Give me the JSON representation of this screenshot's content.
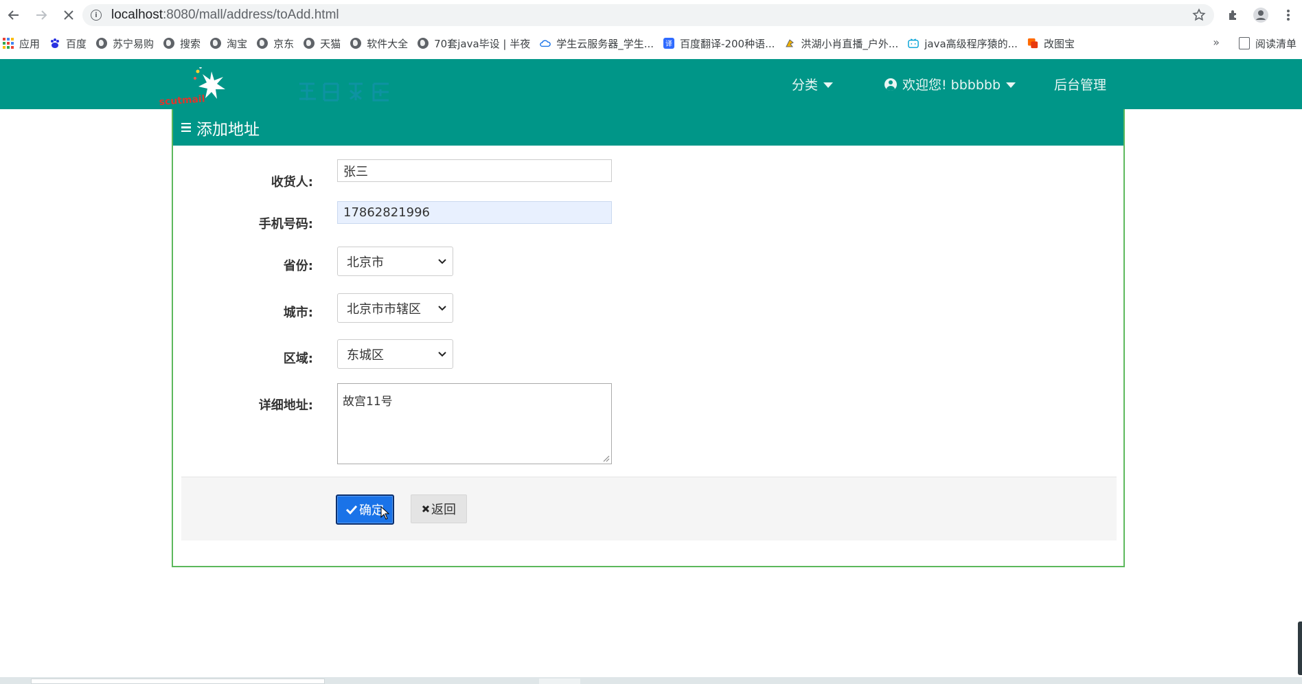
{
  "browser": {
    "url_host": "localhost",
    "url_path": ":8080/mall/address/toAdd.html",
    "bookmarks": [
      {
        "label": "应用",
        "icon": "apps-grid-icon"
      },
      {
        "label": "百度",
        "icon": "baidu-paw-icon"
      },
      {
        "label": "苏宁易购",
        "icon": "globe-icon"
      },
      {
        "label": "搜索",
        "icon": "globe-icon"
      },
      {
        "label": "淘宝",
        "icon": "globe-icon"
      },
      {
        "label": "京东",
        "icon": "globe-icon"
      },
      {
        "label": "天猫",
        "icon": "globe-icon"
      },
      {
        "label": "软件大全",
        "icon": "globe-icon"
      },
      {
        "label": "70套java毕设 | 半夜",
        "icon": "globe-icon"
      },
      {
        "label": "学生云服务器_学生...",
        "icon": "cloud-icon"
      },
      {
        "label": "百度翻译-200种语...",
        "icon": "translate-icon"
      },
      {
        "label": "洪湖小肖直播_户外...",
        "icon": "parrot-icon"
      },
      {
        "label": "java高级程序猿的...",
        "icon": "bilibili-icon"
      },
      {
        "label": "改图宝",
        "icon": "gaitubao-icon"
      }
    ],
    "bookmarks_more": "»",
    "reading_list": "阅读清单"
  },
  "site": {
    "nav_category": "分类",
    "nav_welcome": "欢迎您! bbbbbb",
    "nav_admin": "后台管理"
  },
  "panel": {
    "title": "添加地址"
  },
  "form": {
    "receiver_label": "收货人:",
    "receiver_value": "张三",
    "phone_label": "手机号码:",
    "phone_value": "17862821996",
    "province_label": "省份:",
    "province_value": "北京市",
    "city_label": "城市:",
    "city_value": "北京市市辖区",
    "district_label": "区域:",
    "district_value": "东城区",
    "detail_label": "详细地址:",
    "detail_value": "故宫11号",
    "confirm_label": "确定",
    "back_label": "返回"
  },
  "colors": {
    "brand_teal": "#009688",
    "panel_border": "#5cb85c",
    "confirm_blue": "#1a73e8"
  }
}
